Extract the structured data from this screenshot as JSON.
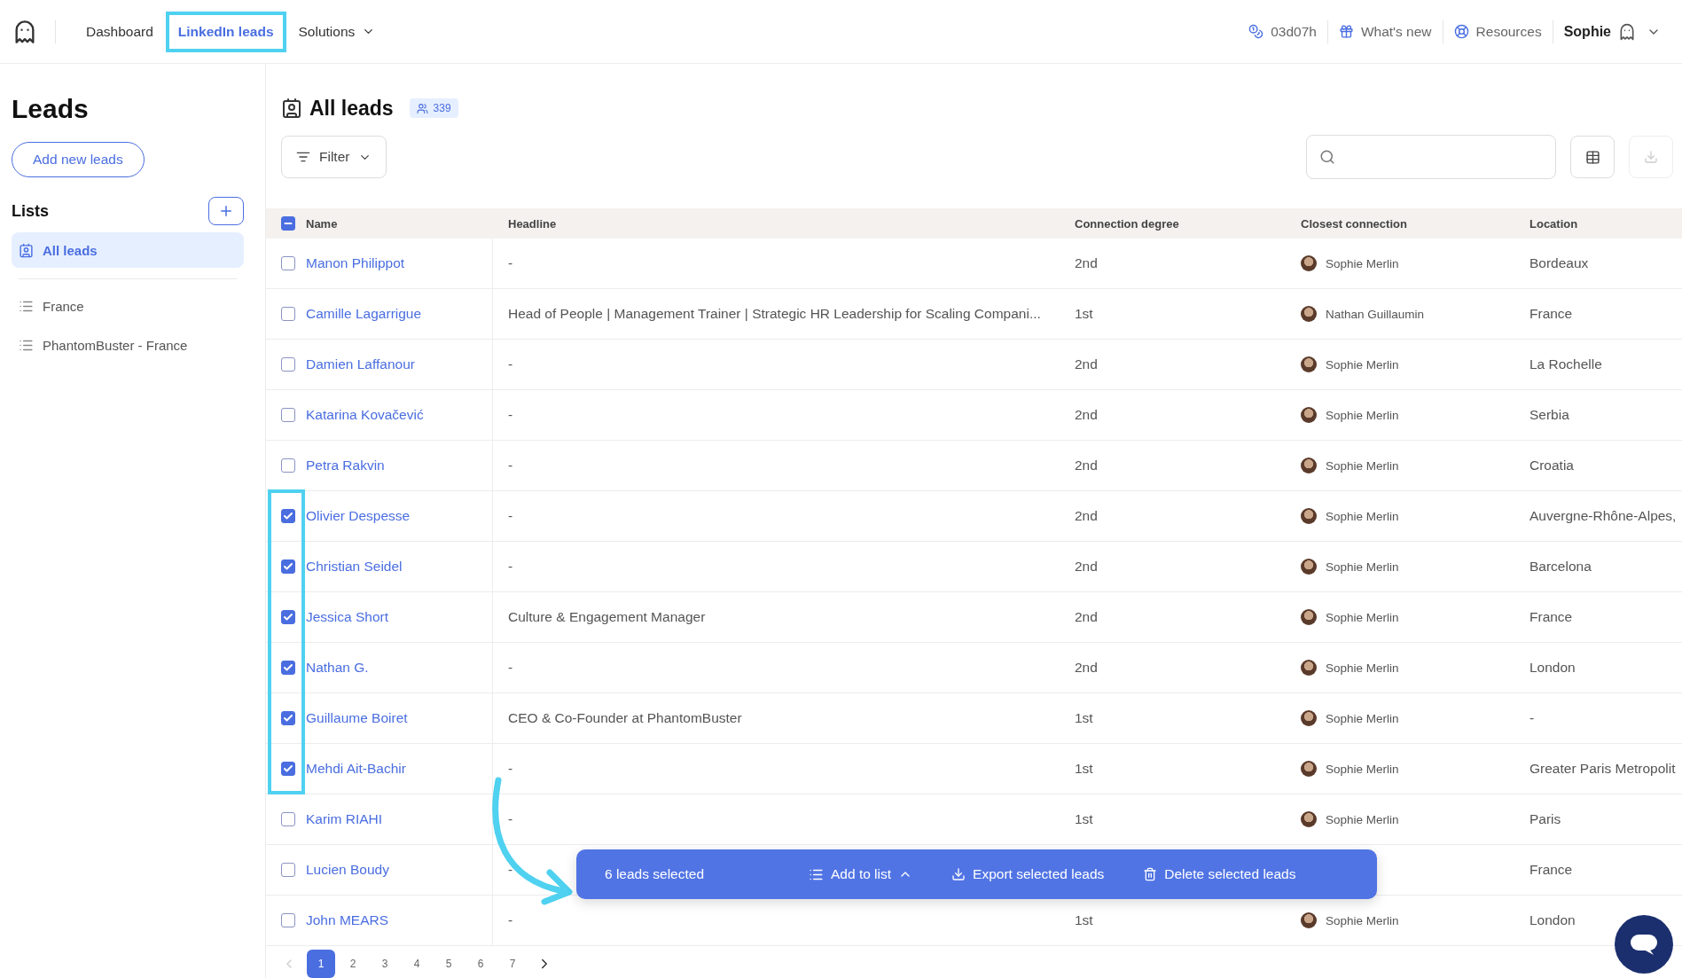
{
  "nav": {
    "items": [
      {
        "label": "Dashboard",
        "selected": false,
        "kind": "link"
      },
      {
        "label": "LinkedIn leads",
        "selected": true,
        "kind": "link"
      },
      {
        "label": "Solutions",
        "selected": false,
        "kind": "menu"
      }
    ],
    "credits": "03d07h",
    "whats_new": "What's new",
    "resources": "Resources",
    "user": "Sophie"
  },
  "sidebar": {
    "title": "Leads",
    "add_button": "Add new leads",
    "lists_title": "Lists",
    "lists": [
      {
        "label": "All leads",
        "selected": true,
        "kind": "all"
      },
      {
        "label": "France",
        "selected": false,
        "kind": "list"
      },
      {
        "label": "PhantomBuster - France",
        "selected": false,
        "kind": "list"
      }
    ]
  },
  "main": {
    "title": "All leads",
    "count": "339",
    "filter": "Filter",
    "select_all_partial": true,
    "columns": [
      "Name",
      "Headline",
      "Connection degree",
      "Closest connection",
      "Location"
    ],
    "rows": [
      {
        "name": "Manon Philippot",
        "headline": "-",
        "degree": "2nd",
        "connection": "Sophie Merlin",
        "location": "Bordeaux",
        "checked": false
      },
      {
        "name": "Camille Lagarrigue",
        "headline": "Head of People | Management Trainer | Strategic HR Leadership for Scaling Compani...",
        "degree": "1st",
        "connection": "Nathan Guillaumin",
        "location": "France",
        "checked": false
      },
      {
        "name": "Damien Laffanour",
        "headline": "-",
        "degree": "2nd",
        "connection": "Sophie Merlin",
        "location": "La Rochelle",
        "checked": false
      },
      {
        "name": "Katarina Kovačević",
        "headline": "-",
        "degree": "2nd",
        "connection": "Sophie Merlin",
        "location": "Serbia",
        "checked": false
      },
      {
        "name": "Petra Rakvin",
        "headline": "-",
        "degree": "2nd",
        "connection": "Sophie Merlin",
        "location": "Croatia",
        "checked": false
      },
      {
        "name": "Olivier Despesse",
        "headline": "-",
        "degree": "2nd",
        "connection": "Sophie Merlin",
        "location": "Auvergne-Rhône-Alpes,",
        "checked": true
      },
      {
        "name": "Christian Seidel",
        "headline": "-",
        "degree": "2nd",
        "connection": "Sophie Merlin",
        "location": "Barcelona",
        "checked": true
      },
      {
        "name": "Jessica Short",
        "headline": "Culture & Engagement Manager",
        "degree": "2nd",
        "connection": "Sophie Merlin",
        "location": "France",
        "checked": true
      },
      {
        "name": "Nathan G.",
        "headline": "-",
        "degree": "2nd",
        "connection": "Sophie Merlin",
        "location": "London",
        "checked": true
      },
      {
        "name": "Guillaume Boiret",
        "headline": "CEO & Co-Founder at PhantomBuster",
        "degree": "1st",
        "connection": "Sophie Merlin",
        "location": "-",
        "checked": true
      },
      {
        "name": "Mehdi Ait-Bachir",
        "headline": "-",
        "degree": "1st",
        "connection": "Sophie Merlin",
        "location": "Greater Paris Metropolit",
        "checked": true
      },
      {
        "name": "Karim RIAHI",
        "headline": "-",
        "degree": "1st",
        "connection": "Sophie Merlin",
        "location": "Paris",
        "checked": false
      },
      {
        "name": "Lucien Boudy",
        "headline": "-",
        "location": "France",
        "checked": false
      },
      {
        "name": "John MEARS",
        "headline": "-",
        "degree": "1st",
        "connection": "Sophie Merlin",
        "location": "London",
        "checked": false
      }
    ]
  },
  "selection_bar": {
    "count": "6 leads selected",
    "actions": [
      {
        "label": "Add to list",
        "kind": "add"
      },
      {
        "label": "Export selected leads",
        "kind": "export"
      },
      {
        "label": "Delete selected leads",
        "kind": "delete"
      }
    ]
  },
  "pagination": {
    "pages": [
      {
        "label": "1",
        "selected": true
      },
      {
        "label": "2",
        "selected": false
      },
      {
        "label": "3",
        "selected": false
      },
      {
        "label": "4",
        "selected": false
      },
      {
        "label": "5",
        "selected": false
      },
      {
        "label": "6",
        "selected": false
      },
      {
        "label": "7",
        "selected": false
      }
    ]
  }
}
